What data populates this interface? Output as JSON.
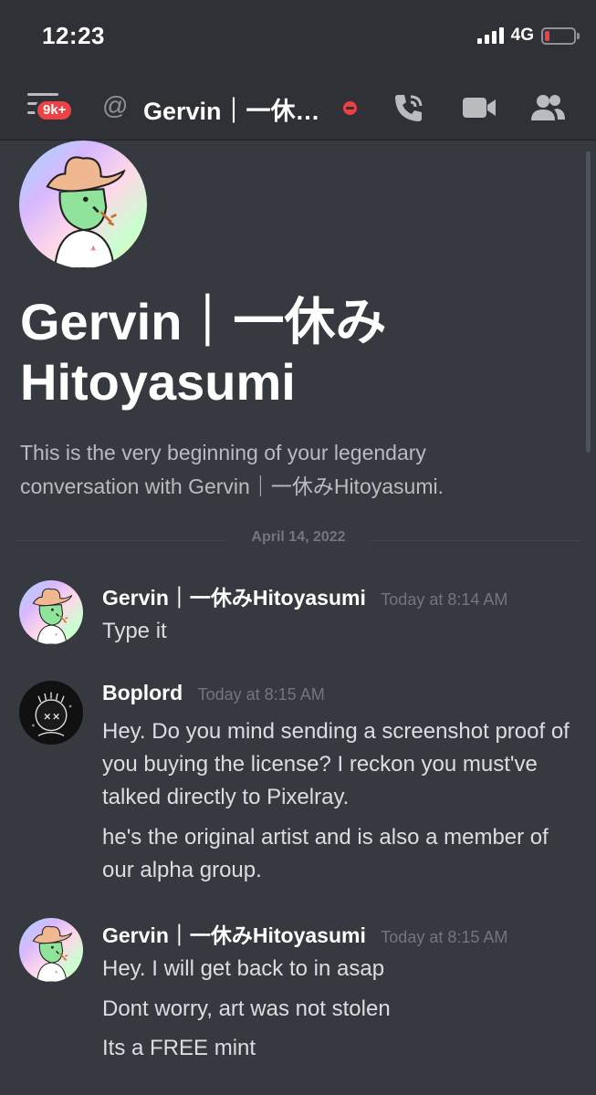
{
  "status_bar": {
    "time": "12:23",
    "network": "4G"
  },
  "header": {
    "unread_badge": "9k+",
    "at_symbol": "@",
    "channel_name": "Gervin｜一休…",
    "icons": [
      "menu-icon",
      "at-icon",
      "call-icon",
      "video-icon",
      "members-icon"
    ],
    "colors": {
      "badge": "#ed4245",
      "dnd": "#ed4245"
    }
  },
  "intro": {
    "title": "Gervin｜一休み Hitoyasumi",
    "description": "This is the very beginning of your legendary conversation with Gervin｜一休みHitoyasumi."
  },
  "divider": {
    "date": "April 14, 2022"
  },
  "messages": [
    {
      "author": "Gervin｜一休みHitoyasumi",
      "timestamp": "Today at 8:14 AM",
      "lines": [
        "Type it"
      ]
    },
    {
      "author": "Boplord",
      "timestamp": "Today at 8:15 AM",
      "lines": [
        "Hey. Do you mind sending a screenshot proof of you buying the license? I reckon you must've talked directly to Pixelray.",
        "he's the original artist and is also a member of our alpha group."
      ]
    },
    {
      "author": "Gervin｜一休みHitoyasumi",
      "timestamp": "Today at 8:15 AM",
      "lines": [
        "Hey. I will get back to in asap",
        "Dont worry, art was not stolen",
        "Its a FREE mint"
      ]
    }
  ]
}
